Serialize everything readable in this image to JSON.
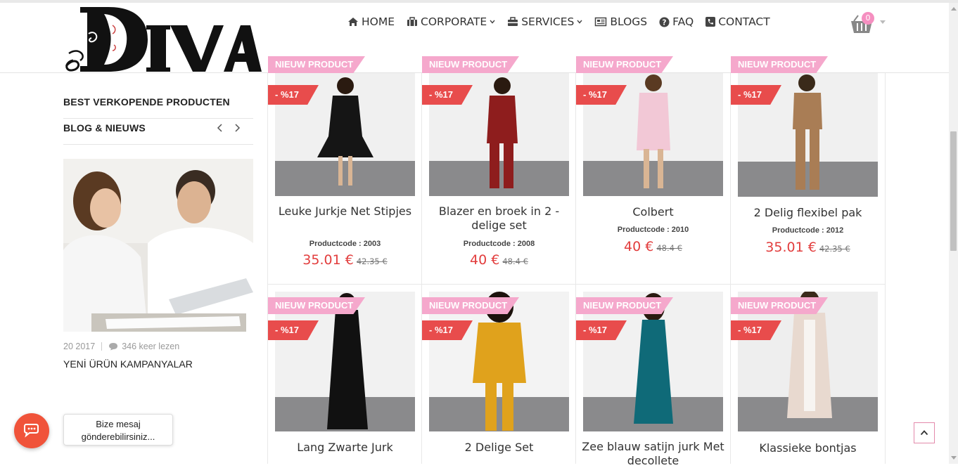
{
  "brand": {
    "logo_text": "DIVA"
  },
  "nav": [
    {
      "label": "HOME",
      "icon": "home-icon",
      "dropdown": false
    },
    {
      "label": "CORPORATE",
      "icon": "briefcase-icon",
      "dropdown": true
    },
    {
      "label": "SERVICES",
      "icon": "toolbox-icon",
      "dropdown": true
    },
    {
      "label": "BLOGS",
      "icon": "newspaper-icon",
      "dropdown": false
    },
    {
      "label": "FAQ",
      "icon": "question-circle-icon",
      "dropdown": false
    },
    {
      "label": "CONTACT",
      "icon": "phone-square-icon",
      "dropdown": false
    }
  ],
  "cart": {
    "count": "0",
    "icon": "basket-icon"
  },
  "sidebar": {
    "best_sellers": "BEST VERKOPENDE PRODUCTEN",
    "blog_heading": "BLOG & NIEUWS",
    "blog_post": {
      "date": "20 2017",
      "views": "346 keer lezen",
      "title": "YENİ ÜRÜN KAMPANYALAR"
    }
  },
  "labels": {
    "new_badge": "NIEUW PRODUCT",
    "discount_badge": "- %17"
  },
  "products_row1": [
    {
      "name": "Leuke Jurkje Net Stipjes",
      "code": "Productcode : 2003",
      "price": "35.01 €",
      "old_price": "42.35 €",
      "dress_color": "#151515"
    },
    {
      "name": "Blazer en broek in 2 - delige set",
      "code": "Productcode : 2008",
      "price": "40 €",
      "old_price": "48.4 €",
      "dress_color": "#8e1d1d"
    },
    {
      "name": "Colbert",
      "code": "Productcode : 2010",
      "price": "40 €",
      "old_price": "48.4 €",
      "dress_color": "#f2c8d6"
    },
    {
      "name": "2 Delig flexibel pak",
      "code": "Productcode : 2012",
      "price": "35.01 €",
      "old_price": "42.35 €",
      "dress_color": "#a97d55"
    }
  ],
  "products_row2": [
    {
      "name": "Lang Zwarte Jurk",
      "dress_color": "#111111"
    },
    {
      "name": "2 Delige Set",
      "dress_color": "#e0a21c"
    },
    {
      "name": "Zee blauw satijn jurk Met decollete",
      "dress_color": "#0f6a78"
    },
    {
      "name": "Klassieke bontjas",
      "dress_color": "#e8d9cf"
    }
  ],
  "chat": {
    "message": "Bize mesaj gönderebilirsiniz..."
  },
  "colors": {
    "accent_red": "#e23d3d",
    "badge_pink": "#f5a8cc",
    "discount_red": "#e84c4c",
    "chat_orange": "#f0533a"
  }
}
